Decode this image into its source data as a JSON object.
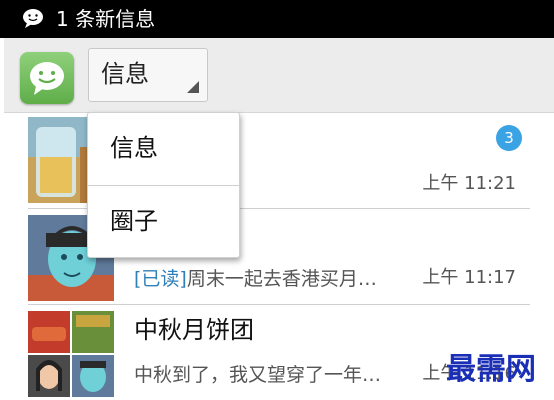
{
  "status_bar": {
    "notification_text": "1 条新信息",
    "icon": "chat-bubble-icon"
  },
  "action_bar": {
    "app_icon": "smiley-chat-icon",
    "spinner_label": "信息",
    "spinner_arrow": "dropdown-triangle-icon"
  },
  "dropdown": {
    "items": [
      {
        "label": "信息"
      },
      {
        "label": "圈子"
      }
    ]
  },
  "conversations": [
    {
      "title": "",
      "preview": "",
      "time": "上午 11:21",
      "unread": "3"
    },
    {
      "title": "",
      "read_tag": "[已读]",
      "preview": "周末一起去香港买月…",
      "time": "上午 11:17"
    },
    {
      "title": "中秋月饼团",
      "preview": "中秋到了，我又望穿了一年…",
      "time": "上午 11:16"
    }
  ],
  "watermark": "最需网",
  "colors": {
    "accent_blue": "#3aa3e3",
    "status_bar": "#000000",
    "action_bar": "#ececec"
  }
}
